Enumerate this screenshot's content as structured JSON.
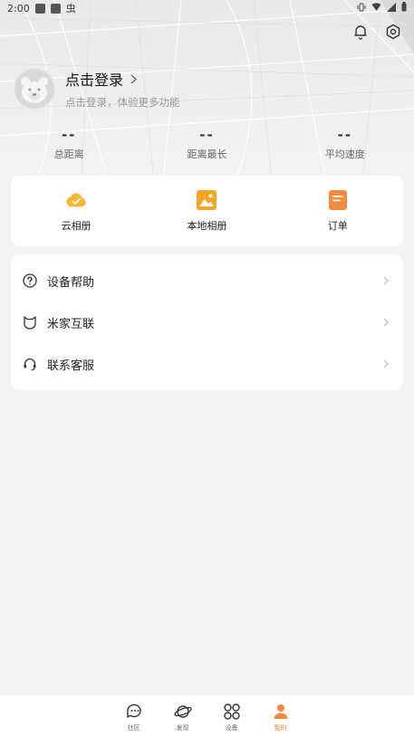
{
  "status_bar": {
    "time": "2:00",
    "app_glyph": "虫"
  },
  "profile": {
    "title": "点击登录",
    "subtitle": "点击登录，体验更多功能"
  },
  "stats": [
    {
      "value": "--",
      "label": "总距离"
    },
    {
      "value": "--",
      "label": "距离最长"
    },
    {
      "value": "--",
      "label": "平均速度"
    }
  ],
  "quick_actions": [
    {
      "label": "云相册",
      "icon": "cloud-album-icon",
      "color": "#f7b733"
    },
    {
      "label": "本地相册",
      "icon": "local-album-icon",
      "color": "#f5a623"
    },
    {
      "label": "订单",
      "icon": "order-icon",
      "color": "#f38b3c"
    }
  ],
  "menu": [
    {
      "label": "设备帮助",
      "icon": "help-circle-icon"
    },
    {
      "label": "米家互联",
      "icon": "mijia-icon"
    },
    {
      "label": "联系客服",
      "icon": "headset-icon"
    }
  ],
  "tabs": [
    {
      "label": "社区",
      "icon": "community-icon",
      "active": false
    },
    {
      "label": "发现",
      "icon": "planet-icon",
      "active": false
    },
    {
      "label": "设备",
      "icon": "device-grid-icon",
      "active": false
    },
    {
      "label": "我的",
      "icon": "profile-icon",
      "active": true
    }
  ],
  "colors": {
    "accent": "#f08a3c",
    "background": "#f3f3f3",
    "card": "#ffffff"
  }
}
